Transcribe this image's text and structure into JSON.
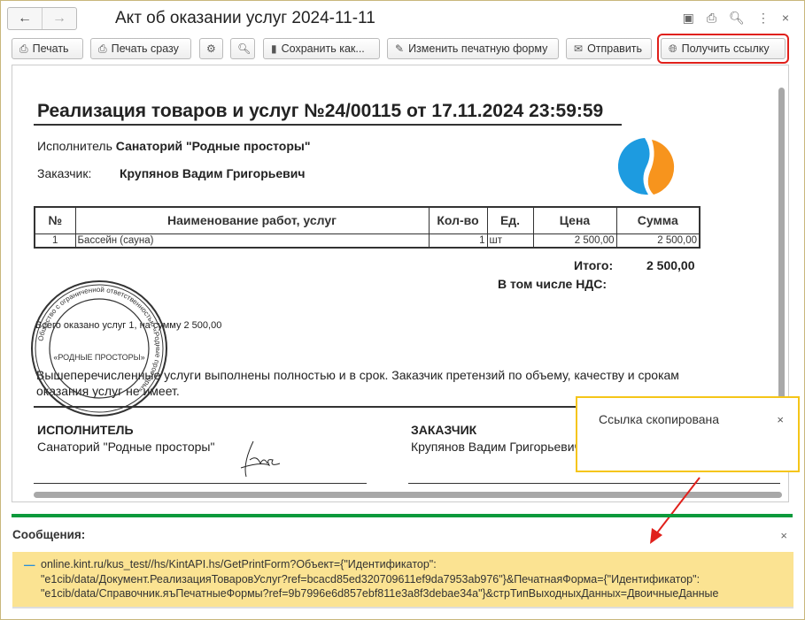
{
  "window": {
    "title": "Акт об оказании услуг 2024-11-11"
  },
  "nav": {
    "back": "←",
    "forward": "→"
  },
  "title_icons": [
    "save-icon",
    "print-icon",
    "preview-icon",
    "more-icon",
    "close-icon"
  ],
  "toolbar": {
    "print": "Печать",
    "print_now": "Печать сразу",
    "save_as": "Сохранить как...",
    "edit_form": "Изменить печатную форму",
    "send": "Отправить",
    "get_link": "Получить ссылку"
  },
  "document": {
    "heading": "Реализация товаров и услуг №24/00115 от 17.11.2024 23:59:59",
    "executor_label": "Исполнитель",
    "executor": "Санаторий \"Родные просторы\"",
    "customer_label": "Заказчик:",
    "customer": "Крупянов Вадим Григорьевич",
    "table": {
      "headers": [
        "№",
        "Наименование работ, услуг",
        "Кол-во",
        "Ед.",
        "Цена",
        "Сумма"
      ],
      "rows": [
        [
          "1",
          "Бассейн (сауна)",
          "1",
          "шт",
          "2 500,00",
          "2 500,00"
        ]
      ]
    },
    "total_label": "Итого:",
    "total": "2 500,00",
    "vat_label": "В том числе НДС:",
    "summary": "Всего оказано услуг 1, на сумму 2 500,00",
    "statement": "Вышеперечисленные услуги выполнены полностью и в срок. Заказчик претензий по объему, качеству и срокам оказания услуг не имеет.",
    "sign_executor_title": "ИСПОЛНИТЕЛЬ",
    "sign_executor": "Санаторий \"Родные просторы\"",
    "sign_customer_title": "ЗАКАЗЧИК",
    "sign_customer": "Крупянов Вадим Григорьевич",
    "stamp_outer": "Общество с ограниченной ответственностью «Родные просторы»",
    "stamp_center": "«РОДНЫЕ ПРОСТОРЫ»"
  },
  "toast": {
    "text": "Ссылка скопирована",
    "close": "×"
  },
  "messages": {
    "title": "Сообщения:",
    "close": "×",
    "lines": [
      "online.kint.ru/kus_test//hs/KintAPI.hs/GetPrintForm?Объект={\"Идентификатор\":",
      "\"e1cib/data/Документ.РеализацияТоваровУслуг?ref=bcacd85ed320709611ef9da7953ab976\"}&ПечатнаяФорма={\"Идентификатор\":",
      "\"e1cib/data/Справочник.яъПечатныеФормы?ref=9b7996e6d857ebf811e3a8f3debae34a\"}&стрТипВыходныхДанных=ДвоичныеДанные"
    ]
  },
  "colors": {
    "highlight": "#e0201b",
    "message_bg": "#fbe392",
    "toast_border": "#f5c518",
    "separator": "#0c9a3c"
  }
}
